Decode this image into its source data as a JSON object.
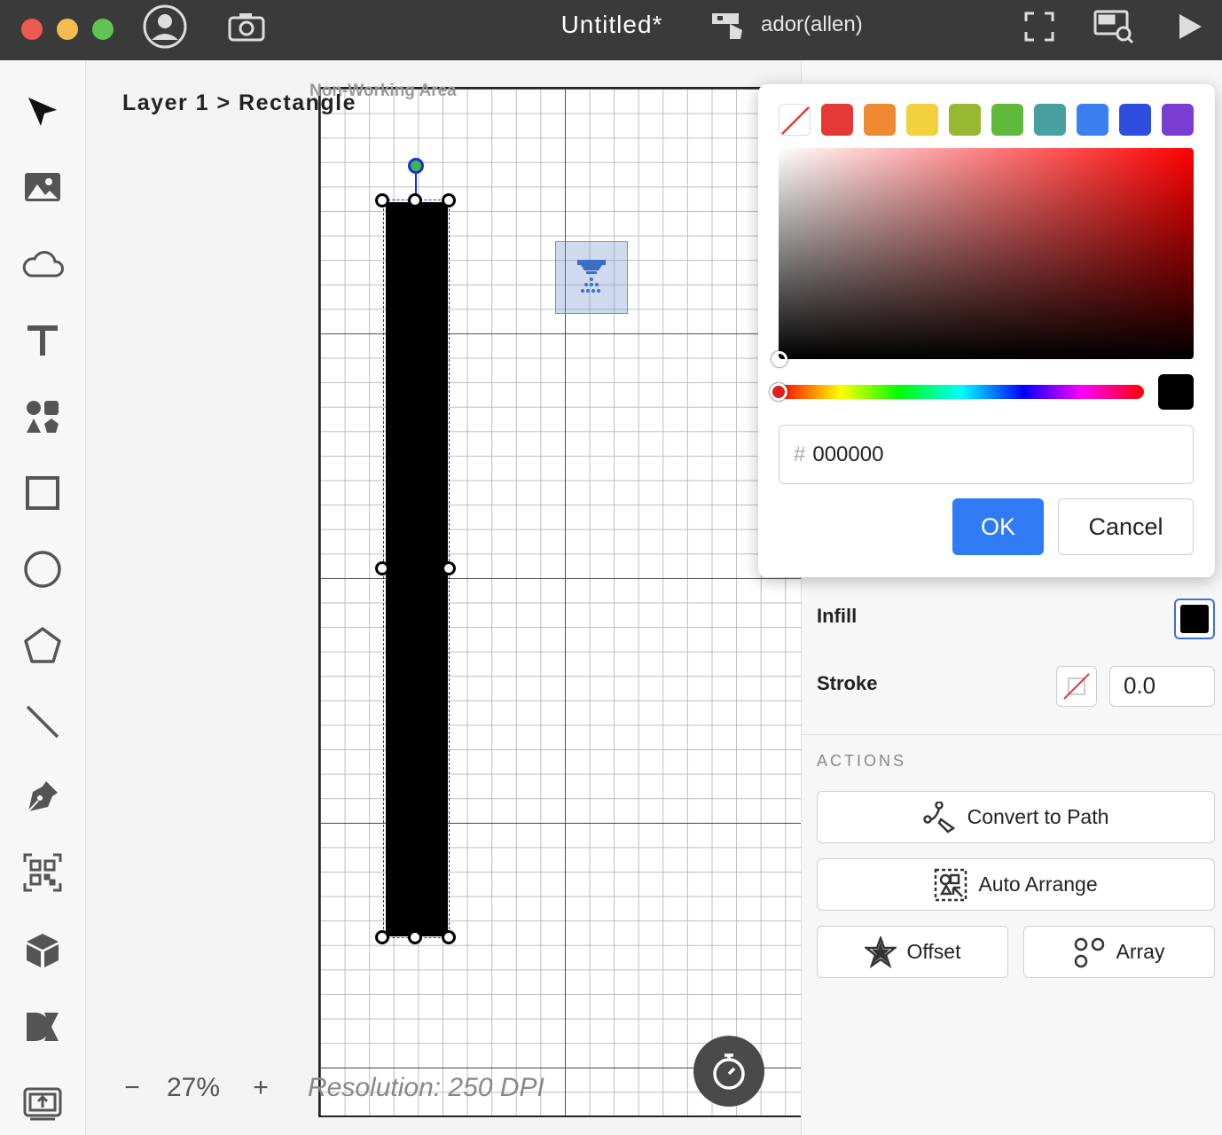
{
  "window": {
    "title": "Untitled*",
    "device_name": "ador(allen)"
  },
  "titlebar_icons": [
    "account-icon",
    "camera-icon",
    "machine-icon",
    "fullscreen-icon",
    "preview-icon",
    "play-icon"
  ],
  "toolbar": {
    "tools": [
      "cursor-icon",
      "image-icon",
      "cloud-icon",
      "text-icon",
      "elements-icon",
      "rectangle-icon",
      "ellipse-icon",
      "polygon-icon",
      "line-icon",
      "pen-icon",
      "qrcode-icon",
      "box-icon",
      "dxf-icon",
      "layer-panel-icon"
    ]
  },
  "canvas": {
    "breadcrumb": "Layer 1 > Rectangle",
    "non_working_area": "Non-Working Area",
    "zoom_minus": "−",
    "zoom_value": "27%",
    "zoom_plus": "+",
    "resolution": "Resolution: 250 DPI"
  },
  "color_picker": {
    "presets": [
      "#e53935",
      "#ef8a32",
      "#f2d03e",
      "#96b833",
      "#5fba3c",
      "#48a0a0",
      "#3b80f0",
      "#2f4ee0",
      "#7a3dd1"
    ],
    "hex_prefix": "#",
    "hex_value": "000000",
    "current_color": "#000000",
    "ok_label": "OK",
    "cancel_label": "Cancel"
  },
  "properties": {
    "infill_label": "Infill",
    "infill_color": "#000000",
    "stroke_label": "Stroke",
    "stroke_width": "0.0"
  },
  "actions": {
    "title": "ACTIONS",
    "convert_to_path": "Convert to Path",
    "auto_arrange": "Auto Arrange",
    "offset": "Offset",
    "array": "Array"
  },
  "colors": {
    "accent": "#2f7bf5",
    "titlebar": "#3a3a3a",
    "selection": "#1a2fd6"
  }
}
